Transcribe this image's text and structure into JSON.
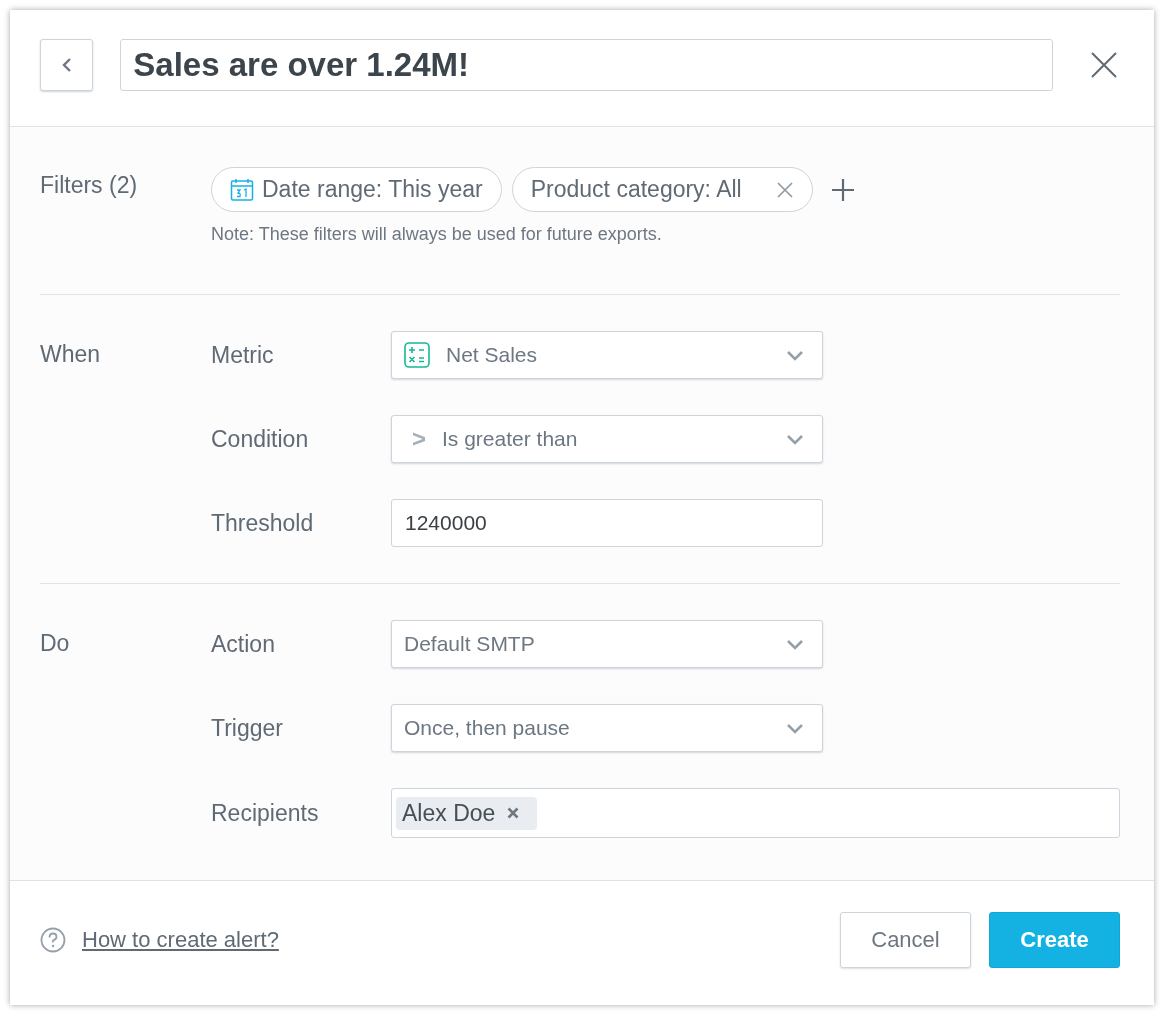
{
  "dialog": {
    "title": "Sales are over 1.24M!"
  },
  "filters": {
    "label": "Filters (2)",
    "note": "Note: These filters will always be used for future exports.",
    "chips": [
      {
        "kind": "date",
        "label": "Date range: This year",
        "removable": false
      },
      {
        "kind": "attribute",
        "label": "Product category: All",
        "removable": true
      }
    ]
  },
  "sections": [
    {
      "label": "When",
      "fields": [
        {
          "kind": "metric",
          "label": "Metric",
          "value": "Net Sales"
        },
        {
          "kind": "select",
          "label": "Condition",
          "prefix": ">",
          "value": "Is greater than"
        },
        {
          "kind": "input",
          "label": "Threshold",
          "value": "1240000"
        }
      ]
    },
    {
      "label": "Do",
      "fields": [
        {
          "kind": "select",
          "label": "Action",
          "value": "Default SMTP"
        },
        {
          "kind": "select",
          "label": "Trigger",
          "value": "Once, then pause"
        },
        {
          "kind": "recipients",
          "label": "Recipients",
          "tags": [
            "Alex Doe"
          ]
        }
      ]
    }
  ],
  "footer": {
    "help_link": "How to create alert?",
    "buttons": [
      {
        "kind": "secondary",
        "label": "Cancel"
      },
      {
        "kind": "primary",
        "label": "Create"
      }
    ]
  }
}
